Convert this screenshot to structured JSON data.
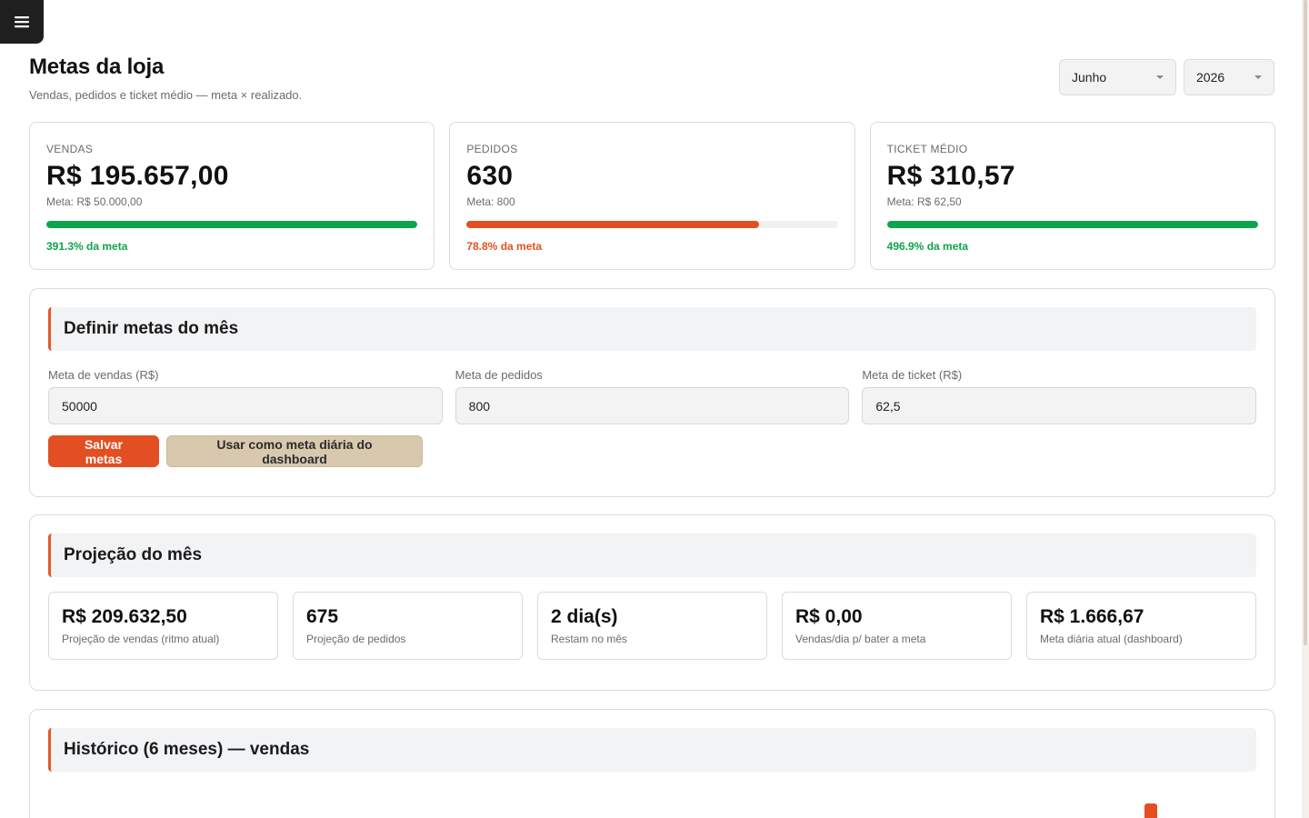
{
  "page": {
    "title": "Metas da loja",
    "subtitle": "Vendas, pedidos e ticket médio — meta × realizado."
  },
  "filters": {
    "month": "Junho",
    "year": "2026"
  },
  "kpis": [
    {
      "label": "VENDAS",
      "value": "R$ 195.657,00",
      "goal": "Meta: R$ 50.000,00",
      "progress": 1.0,
      "pct": "391.3% da meta",
      "color": "#0ea44b"
    },
    {
      "label": "PEDIDOS",
      "value": "630",
      "goal": "Meta: 800",
      "progress": 0.788,
      "pct": "78.8% da meta",
      "color": "#e34f22"
    },
    {
      "label": "TICKET MÉDIO",
      "value": "R$ 310,57",
      "goal": "Meta: R$ 62,50",
      "progress": 1.0,
      "pct": "496.9% da meta",
      "color": "#0ea44b"
    }
  ],
  "goals_form": {
    "title": "Definir metas do mês",
    "sales_label": "Meta de vendas (R$)",
    "sales_value": "50000",
    "orders_label": "Meta de pedidos",
    "orders_value": "800",
    "ticket_label": "Meta de ticket (R$)",
    "ticket_value": "62,5",
    "save_label": "Salvar metas",
    "use_daily_label": "Usar como meta diária do dashboard"
  },
  "projection": {
    "title": "Projeção do mês",
    "items": [
      {
        "value": "R$ 209.632,50",
        "label": "Projeção de vendas (ritmo atual)"
      },
      {
        "value": "675",
        "label": "Projeção de pedidos"
      },
      {
        "value": "2 dia(s)",
        "label": "Restam no mês"
      },
      {
        "value": "R$ 0,00",
        "label": "Vendas/dia p/ bater a meta"
      },
      {
        "value": "R$ 1.666,67",
        "label": "Meta diária atual (dashboard)"
      }
    ]
  },
  "history": {
    "title": "Histórico (6 meses) — vendas"
  },
  "colors": {
    "accent": "#e34f22",
    "success": "#0ea44b",
    "secondary_button": "#d8c8ad"
  }
}
